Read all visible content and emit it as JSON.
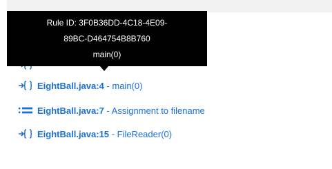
{
  "tooltip": {
    "line1": "Rule ID: 3F0B36DD-4C18-4E09-",
    "line2": "89BC-D464754B8B760",
    "line3": "main(0)"
  },
  "trace": {
    "items": [
      {
        "icon": "call-icon",
        "file": "EightBall.java:4",
        "sep": " - ",
        "desc": "main(0)"
      },
      {
        "icon": "assignment-icon",
        "file": "EightBall.java:7",
        "sep": " - ",
        "desc": "Assignment to filename"
      },
      {
        "icon": "call-icon",
        "file": "EightBall.java:15",
        "sep": " - ",
        "desc": "FileReader(0)"
      }
    ]
  },
  "colors": {
    "link": "#1a6fd6",
    "tooltip_bg": "#000000"
  }
}
